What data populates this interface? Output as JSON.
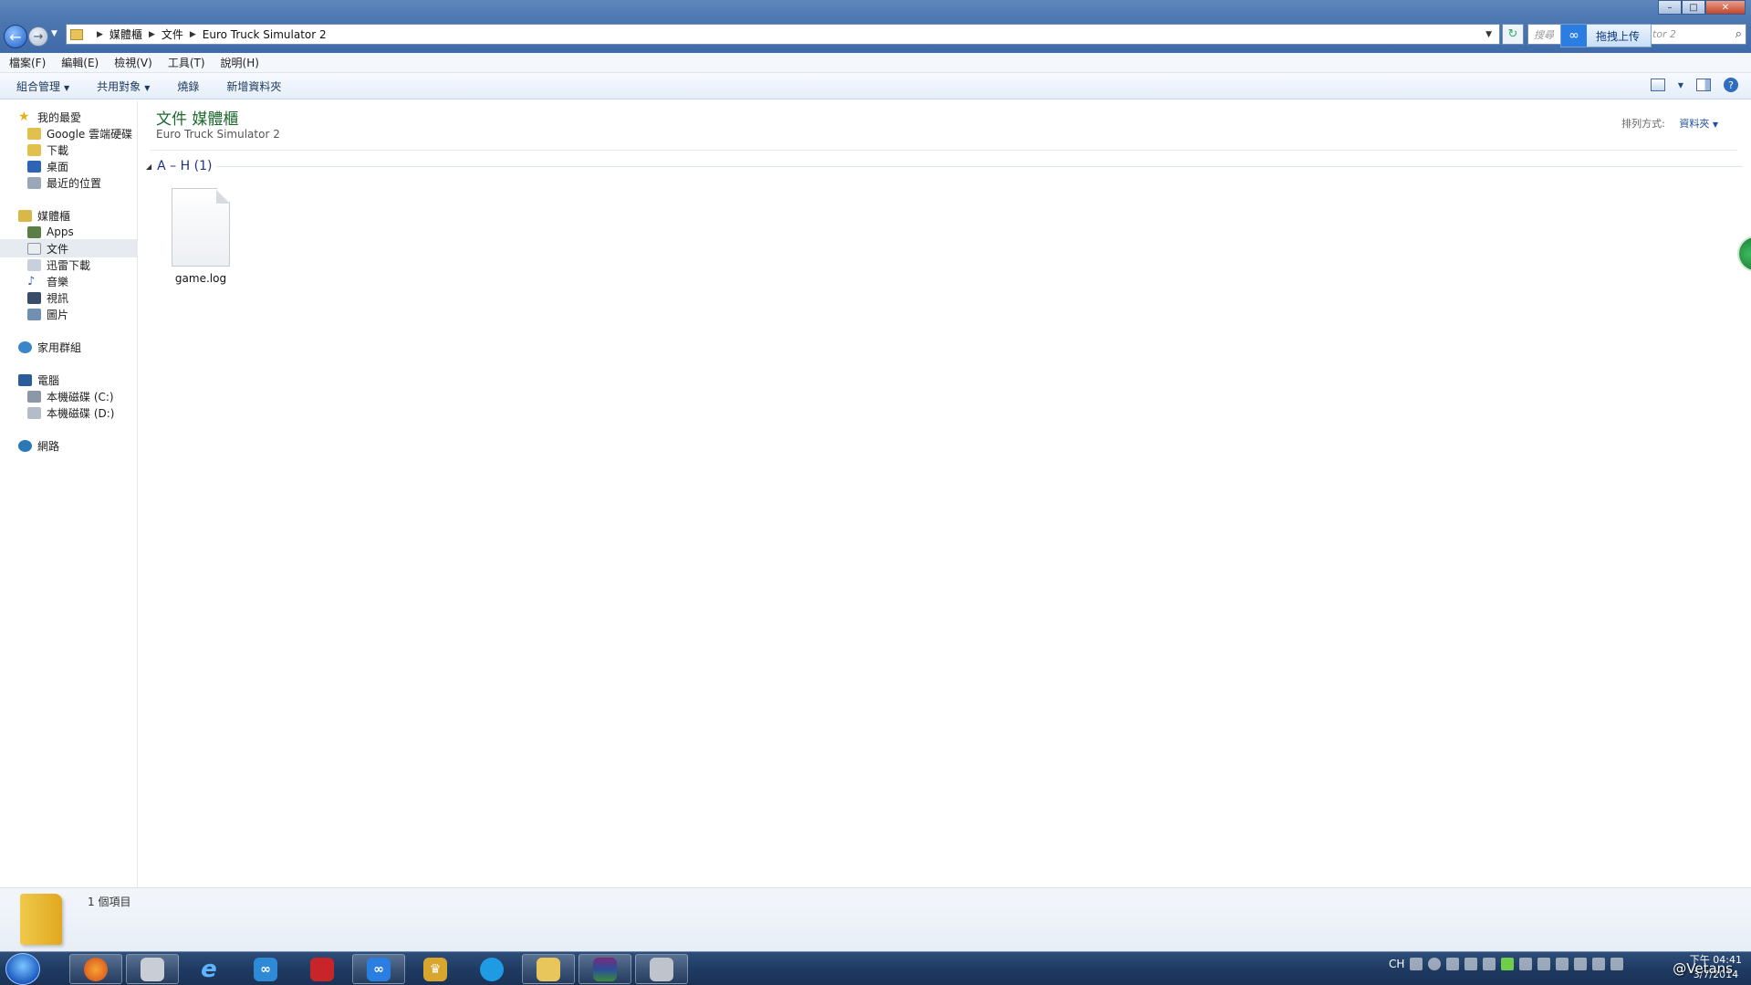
{
  "address": {
    "crumbs": [
      "媒體櫃",
      "文件",
      "Euro Truck Simulator 2"
    ]
  },
  "search": {
    "placeholder": "搜尋",
    "suffix": "tor 2"
  },
  "upload": {
    "label": "拖拽上传"
  },
  "menubar": [
    "檔案(F)",
    "編輯(E)",
    "檢視(V)",
    "工具(T)",
    "說明(H)"
  ],
  "cmdbar": {
    "organize": "組合管理",
    "share": "共用對象",
    "burn": "燒錄",
    "new_folder": "新增資料夾"
  },
  "nav": {
    "favorites": "我的最愛",
    "fav_items": [
      "Google 雲端硬碟",
      "下載",
      "桌面",
      "最近的位置"
    ],
    "libraries": "媒體櫃",
    "lib_items": [
      "Apps",
      "文件",
      "迅雷下載",
      "音樂",
      "視訊",
      "圖片"
    ],
    "homegroup": "家用群組",
    "computer": "電腦",
    "drives": [
      "本機磁碟 (C:)",
      "本機磁碟 (D:)"
    ],
    "network": "網路"
  },
  "content": {
    "title": "文件 媒體櫃",
    "subtitle": "Euro Truck Simulator 2",
    "arrange_label": "排列方式:",
    "arrange_value": "資料夾",
    "group_label": "A – H (1)",
    "files": [
      {
        "name": "game.log"
      }
    ]
  },
  "details": {
    "count": "1 個項目"
  },
  "taskbar": {
    "tray_lang": "CH",
    "time": "下午 04:41",
    "date": "3/7/2014"
  },
  "watermark": "@Vetans",
  "colors": {
    "title_green": "#1e6a2e",
    "link_blue": "#1f4f9e",
    "taskbar": "#1f3b63"
  }
}
